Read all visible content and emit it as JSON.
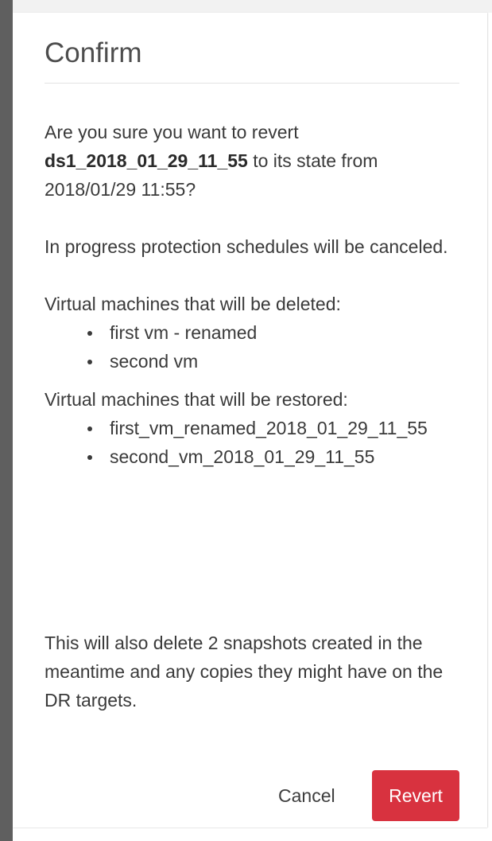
{
  "dialog": {
    "title": "Confirm",
    "intro": {
      "prefix": "Are you sure you want to revert ",
      "datastore": "ds1_2018_01_29_11_55",
      "suffix": " to its state from 2018/01/29 11:55?"
    },
    "schedules_note": "In progress protection schedules will be canceled.",
    "deleted_heading": "Virtual machines that will be deleted:",
    "deleted_vms": [
      "first vm - renamed",
      "second vm"
    ],
    "restored_heading": "Virtual machines that will be restored:",
    "restored_vms": [
      "first_vm_renamed_2018_01_29_11_55",
      "second_vm_2018_01_29_11_55"
    ],
    "snapshots_note": "This will also delete 2 snapshots created in the meantime and any copies they might have on the DR targets.",
    "cancel_label": "Cancel",
    "revert_label": "Revert"
  },
  "colors": {
    "revert_button": "#d8323f",
    "left_bar": "#5f5f5f"
  }
}
